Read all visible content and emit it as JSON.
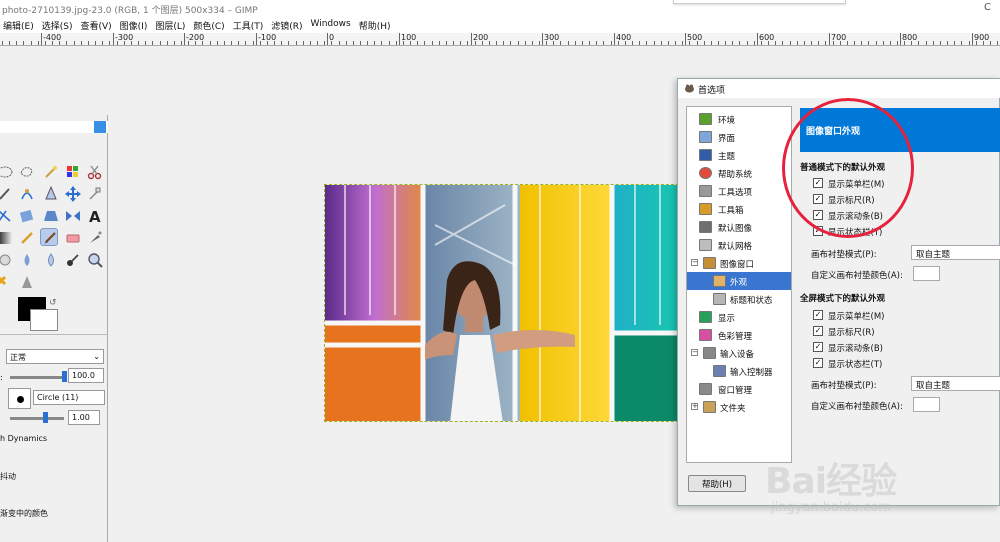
{
  "window": {
    "title": "photo-2710139.jpg-23.0 (RGB, 1 个图层) 500x334 – GIMP",
    "minimize": "─",
    "maximize": "□"
  },
  "menubar": {
    "items": [
      "编辑(E)",
      "选择(S)",
      "查看(V)",
      "图像(I)",
      "图层(L)",
      "颜色(C)",
      "工具(T)",
      "滤镜(R)",
      "Windows",
      "帮助(H)"
    ]
  },
  "ruler": {
    "labels": [
      "-400",
      "-300",
      "-200",
      "-100",
      "0",
      "100",
      "200",
      "300",
      "400",
      "500",
      "600",
      "700",
      "800",
      "900"
    ]
  },
  "toolbox": {
    "mode": "正常",
    "opacity": "100.0",
    "brush": "Circle (11)",
    "size": "1.00",
    "dynamics_label": "h Dynamics",
    "jitter_label": "抖动",
    "gradient_label": "渐变中的颜色"
  },
  "prefs": {
    "title": "首选项",
    "tree": [
      {
        "label": "环境",
        "color": "#5aa02c"
      },
      {
        "label": "界面",
        "color": "#7da7d9"
      },
      {
        "label": "主题",
        "color": "#2f5da8"
      },
      {
        "label": "帮助系统",
        "color": "#e24a3b"
      },
      {
        "label": "工具选项",
        "color": "#9a9a9a"
      },
      {
        "label": "工具箱",
        "color": "#d79b2a"
      },
      {
        "label": "默认图像",
        "color": "#6f6f6f"
      },
      {
        "label": "默认网格",
        "color": "#bdbdbd"
      },
      {
        "label": "图像窗口",
        "color": "#c58f3a"
      },
      {
        "label": "外观",
        "color": "#e0b36a"
      },
      {
        "label": "标题和状态",
        "color": "#b6b6b6"
      },
      {
        "label": "显示",
        "color": "#27a05a"
      },
      {
        "label": "色彩管理",
        "color": "#d64fa0"
      },
      {
        "label": "输入设备",
        "color": "#888888"
      },
      {
        "label": "输入控制器",
        "color": "#6b7fb0"
      },
      {
        "label": "窗口管理",
        "color": "#8a8a8a"
      },
      {
        "label": "文件夹",
        "color": "#c9a25a"
      }
    ],
    "help_button": "帮助(H)",
    "panel_title": "图像窗口外观",
    "normal_section": "普通模式下的默认外观",
    "normal_checks": [
      "显示菜单栏(M)",
      "显示标尺(R)",
      "显示滚动条(B)",
      "显示状态栏(T)"
    ],
    "normal_padding_mode_label": "画布衬垫模式(P):",
    "normal_padding_mode_value": "取自主题",
    "normal_padding_color_label": "自定义画布衬垫颜色(A):",
    "fullscreen_section": "全屏模式下的默认外观",
    "fullscreen_checks": [
      "显示菜单栏(M)",
      "显示标尺(R)",
      "显示滚动条(B)",
      "显示状态栏(T)"
    ],
    "fullscreen_padding_mode_label": "画布衬垫模式(P):",
    "fullscreen_padding_mode_value": "取自主题",
    "fullscreen_padding_color_label": "自定义画布衬垫颜色(A):",
    "checked_mark": "✓"
  },
  "watermark": {
    "brand": "Bai经验",
    "url": "jingyan.baidu.com"
  },
  "colors": {
    "accent": "#0078d7",
    "selection": "#3a76d0",
    "annotation": "#e5233d"
  }
}
